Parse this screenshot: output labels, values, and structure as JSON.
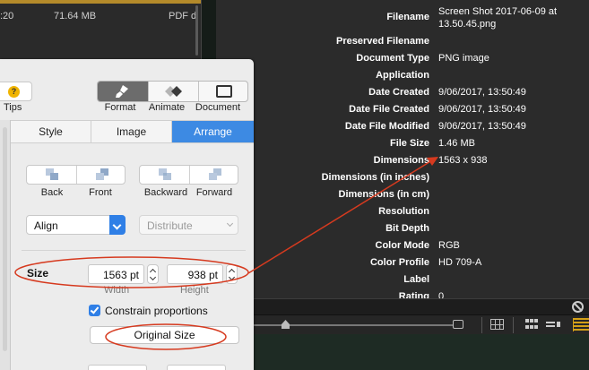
{
  "file_list": {
    "row": {
      "time": ":20",
      "size": "71.64 MB",
      "kind": "PDF d"
    }
  },
  "info_panel": {
    "rows": [
      {
        "label": "Filename",
        "value": "Screen Shot 2017-06-09 at",
        "value2": "13.50.45.png"
      },
      {
        "label": "Preserved Filename",
        "value": ""
      },
      {
        "label": "Document Type",
        "value": "PNG image"
      },
      {
        "label": "Application",
        "value": ""
      },
      {
        "label": "Date Created",
        "value": "9/06/2017, 13:50:49"
      },
      {
        "label": "Date File Created",
        "value": "9/06/2017, 13:50:49"
      },
      {
        "label": "Date File Modified",
        "value": "9/06/2017, 13:50:49"
      },
      {
        "label": "File Size",
        "value": "1.46 MB"
      },
      {
        "label": "Dimensions",
        "value": "1563 x 938"
      },
      {
        "label": "Dimensions (in inches)",
        "value": ""
      },
      {
        "label": "Dimensions (in cm)",
        "value": ""
      },
      {
        "label": "Resolution",
        "value": ""
      },
      {
        "label": "Bit Depth",
        "value": ""
      },
      {
        "label": "Color Mode",
        "value": "RGB"
      },
      {
        "label": "Color Profile",
        "value": "HD 709-A"
      },
      {
        "label": "Label",
        "value": ""
      },
      {
        "label": "Rating",
        "value": "0"
      }
    ]
  },
  "inspector": {
    "tips_label": "Tips",
    "tips_icon": "?",
    "format_label": "Format",
    "animate_label": "Animate",
    "document_label": "Document",
    "tabs": [
      "Style",
      "Image",
      "Arrange"
    ],
    "active_tab": "Arrange",
    "back_label": "Back",
    "front_label": "Front",
    "backward_label": "Backward",
    "forward_label": "Forward",
    "align_value": "Align",
    "distribute_value": "Distribute",
    "size_label": "Size",
    "width_value": "1563 pt",
    "height_value": "938 pt",
    "width_sublabel": "Width",
    "height_sublabel": "Height",
    "constrain_label": "Constrain proportions",
    "constrain_checked": true,
    "original_size_label": "Original Size"
  },
  "colors": {
    "accent": "#3d8ae3",
    "annotation": "#d63a1f",
    "rating_bar": "#d4a017"
  },
  "icons": [
    "tips-icon",
    "paintbrush-icon",
    "animate-icon",
    "document-icon",
    "send-back-icon",
    "bring-front-icon",
    "backward-icon",
    "forward-icon",
    "no-entry-icon",
    "grid-view-icon",
    "list-view-icon",
    "column-view-icon"
  ]
}
